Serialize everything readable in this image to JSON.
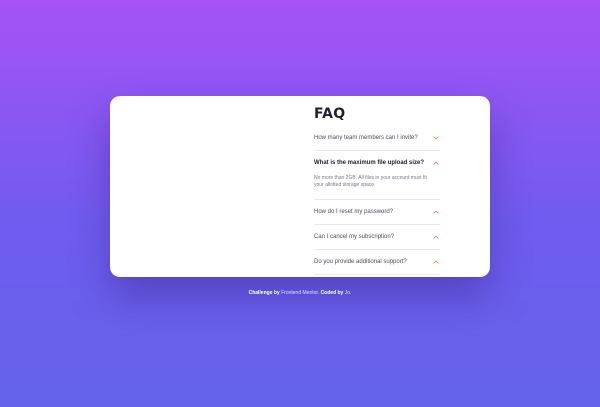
{
  "faq": {
    "title": "FAQ",
    "items": [
      {
        "question": "How many team members can I invite?",
        "state": "collapsed",
        "chevron": "chevron-down-icon"
      },
      {
        "question": "What is the maximum file upload size?",
        "answer": "No more than 2GB. All files in your account must fit your allotted storage space.",
        "state": "expanded",
        "chevron": "chevron-up-icon"
      },
      {
        "question": "How do I reset my password?",
        "state": "collapsed",
        "chevron": "chevron-up-icon"
      },
      {
        "question": "Can I cancel my subscription?",
        "state": "collapsed",
        "chevron": "chevron-up-icon"
      },
      {
        "question": "Do you provide additional support?",
        "state": "collapsed",
        "chevron": "chevron-up-icon"
      }
    ]
  },
  "attribution": {
    "challenge_prefix": "Challenge by",
    "challenge_link": "Frontend Mentor",
    "coded_prefix": "Coded by",
    "coded_link": "Jo."
  },
  "colors": {
    "background_top": "#a652f6",
    "background_bottom": "#6463e9",
    "card": "#ffffff",
    "chevron": "#f47c57",
    "heading": "#1e1f36"
  }
}
